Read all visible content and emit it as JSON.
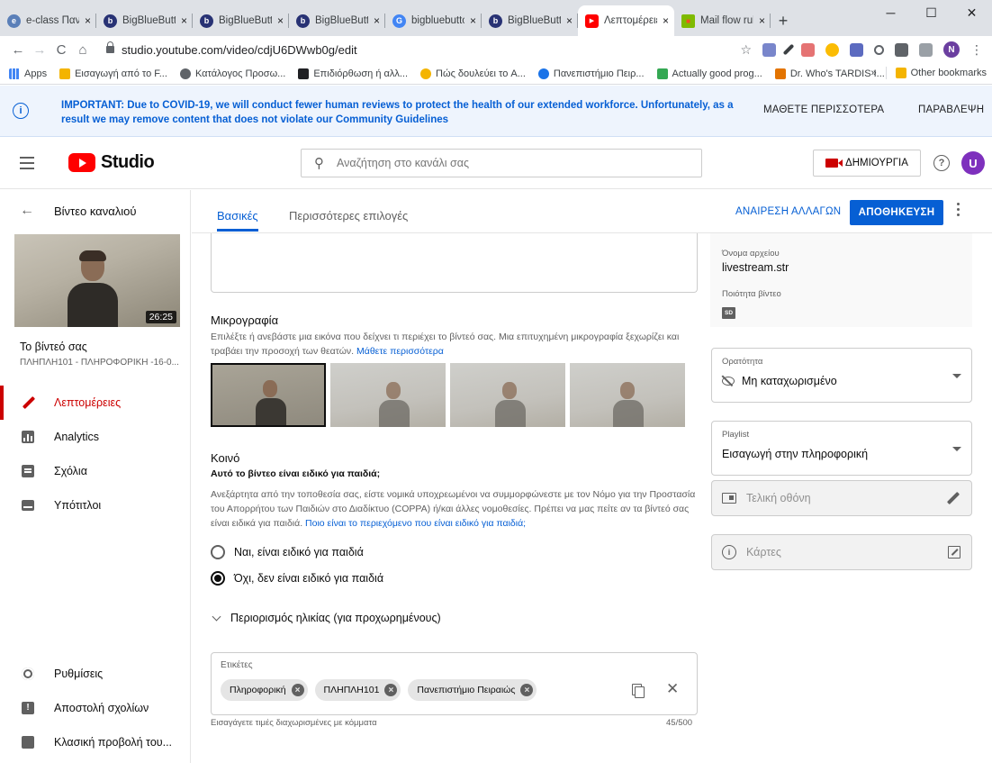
{
  "browser": {
    "tabs": [
      {
        "label": "e-class Πανεπ",
        "fav_color": "#5a7fb8",
        "fav_glyph": "e"
      },
      {
        "label": "BigBlueButton",
        "fav_color": "#283274",
        "fav_glyph": "b"
      },
      {
        "label": "BigBlueButton",
        "fav_color": "#283274",
        "fav_glyph": "b"
      },
      {
        "label": "BigBlueButton",
        "fav_color": "#283274",
        "fav_glyph": "b"
      },
      {
        "label": "bigbluebutton",
        "fav_color": "#4285f4",
        "fav_glyph": "G"
      },
      {
        "label": "BigBlueButton",
        "fav_color": "#283274",
        "fav_glyph": "b"
      },
      {
        "label": "Λεπτομέρειες",
        "fav_color": "#ff0000",
        "fav_glyph": "▶"
      },
      {
        "label": "Mail flow rule",
        "fav_color": "#f25022",
        "fav_glyph": "■"
      }
    ],
    "tab_close": "×",
    "new_tab": "+",
    "win_min": "─",
    "win_max": "☐",
    "win_close": "✕",
    "url": "studio.youtube.com/video/cdjU6DWwb0g/edit",
    "bookmarks": [
      {
        "label": "Apps",
        "color": "#4285f4"
      },
      {
        "label": "Εισαγωγή από το F...",
        "color": "#f4b400"
      },
      {
        "label": "Κατάλογος Προσω...",
        "color": "#5f6368"
      },
      {
        "label": "Επιδιόρθωση ή αλλ...",
        "color": "#202124"
      },
      {
        "label": "Πώς δουλεύει το A...",
        "color": "#f4b400"
      },
      {
        "label": "Πανεπιστήμιο Πειρ...",
        "color": "#1a73e8"
      },
      {
        "label": "Actually good prog...",
        "color": "#34a853"
      },
      {
        "label": "Dr. Who's TARDIS I...",
        "color": "#e37400"
      }
    ],
    "bookmarks_more": "»",
    "other_bookmarks": "Other bookmarks"
  },
  "banner": {
    "message": "IMPORTANT: Due to COVID-19, we will conduct fewer human reviews to protect the health of our extended workforce. Unfortunately, as a result we may remove content that does not violate our Community Guidelines",
    "learn_more": "ΜΑΘΕΤΕ ΠΕΡΙΣΣΟΤΕΡΑ",
    "dismiss": "ΠΑΡΑΒΛΕΨΗ"
  },
  "header": {
    "logo_text": "Studio",
    "search_placeholder": "Αναζήτηση στο κανάλι σας",
    "create_label": "ΔΗΜΙΟΥΡΓΙΑ",
    "avatar_letter": "U"
  },
  "sidebar": {
    "back_label": "Βίντεο καναλιού",
    "duration": "26:25",
    "your_video": "Το βίντεό σας",
    "video_subtitle": "ΠΛΗΠΛΗ101 - ΠΛΗΡΟΦΟΡΙΚΗ -16-0...",
    "nav": [
      {
        "label": "Λεπτομέρειες",
        "icon": "pencil-icon",
        "active": true
      },
      {
        "label": "Analytics",
        "icon": "analytics-icon",
        "active": false
      },
      {
        "label": "Σχόλια",
        "icon": "comments-icon",
        "active": false
      },
      {
        "label": "Υπότιτλοι",
        "icon": "subtitles-icon",
        "active": false
      }
    ],
    "bottom_nav": [
      {
        "label": "Ρυθμίσεις",
        "icon": "gear-icon"
      },
      {
        "label": "Αποστολή σχολίων",
        "icon": "feedback-icon"
      },
      {
        "label": "Κλασική προβολή του...",
        "icon": "classic-studio-icon"
      }
    ]
  },
  "main": {
    "tabs": [
      "Βασικές",
      "Περισσότερες επιλογές"
    ],
    "undo_label": "ΑΝΑΙΡΕΣΗ ΑΛΛΑΓΩΝ",
    "save_label": "ΑΠΟΘΗΚΕΥΣΗ",
    "thumbnail": {
      "heading": "Μικρογραφία",
      "text": "Επιλέξτε ή ανεβάστε μια εικόνα που δείχνει τι περιέχει το βίντεό σας. Μια επιτυχημένη μικρογραφία ξεχωρίζει και τραβάει την προσοχή των θεατών.",
      "link": "Μάθετε περισσότερα"
    },
    "audience": {
      "heading": "Κοινό",
      "question": "Αυτό το βίντεο είναι ειδικό για παιδιά;",
      "text": "Ανεξάρτητα από την τοποθεσία σας, είστε νομικά υποχρεωμένοι να συμμορφώνεστε με τον Νόμο για την Προστασία του Απορρήτου των Παιδιών στο Διαδίκτυο (COPPA) ή/και άλλες νομοθεσίες. Πρέπει να μας πείτε αν τα βίντεό σας είναι ειδικά για παιδιά.",
      "link": "Ποιο είναι το περιεχόμενο που είναι ειδικό για παιδιά;",
      "option_yes": "Ναι, είναι ειδικό για παιδιά",
      "option_no": "Όχι, δεν είναι ειδικό για παιδιά",
      "selected": "no"
    },
    "age_restriction": "Περιορισμός ηλικίας (για προχωρημένους)",
    "tags": {
      "label": "Ετικέτες",
      "items": [
        "Πληροφορική",
        "ΠΛΗΠΛΗ101",
        "Πανεπιστήμιο Πειραιώς"
      ],
      "hint": "Εισαγάγετε τιμές διαχωρισμένες με κόμματα",
      "count": "45/500"
    }
  },
  "right": {
    "filename_label": "Όνομα αρχείου",
    "filename": "livestream.str",
    "quality_label": "Ποιότητα βίντεο",
    "quality_badge": "SD",
    "visibility_label": "Ορατότητα",
    "visibility_value": "Μη καταχωρισμένο",
    "playlist_label": "Playlist",
    "playlist_value": "Εισαγωγή στην πληροφορική",
    "endscreen_label": "Τελική οθόνη",
    "cards_label": "Κάρτες"
  },
  "colors": {
    "accent": "#065fd4",
    "active_nav": "#cc0000",
    "brand": "#ff0000"
  }
}
